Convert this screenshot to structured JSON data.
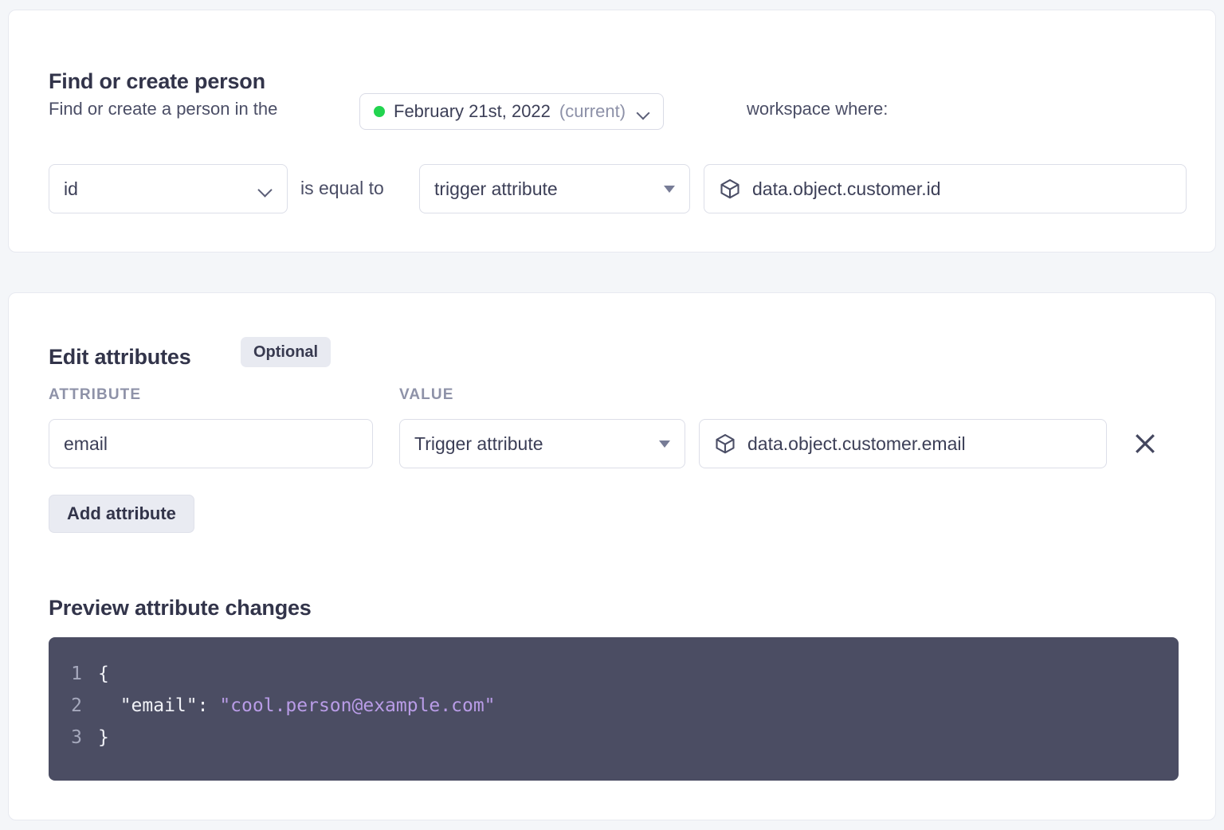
{
  "find_card": {
    "title": "Find or create person",
    "lead_text": "Find or create a person in the",
    "workspace": {
      "name": "February 21st, 2022",
      "status": "(current)",
      "dot_color": "#22d44f"
    },
    "trailing_text": "workspace where:",
    "condition": {
      "attribute_value": "id",
      "operator_label": "is equal to",
      "source_value": "trigger attribute",
      "path_value": "data.object.customer.id",
      "path_icon": "cube-icon"
    }
  },
  "edit_card": {
    "title": "Edit attributes",
    "badge": "Optional",
    "columns": {
      "attribute": "ATTRIBUTE",
      "value": "VALUE"
    },
    "rows": [
      {
        "attribute": "email",
        "source": "Trigger attribute",
        "path": "data.object.customer.email",
        "path_icon": "cube-icon",
        "remove_icon": "close-icon"
      }
    ],
    "add_button": "Add attribute",
    "preview_title": "Preview attribute changes",
    "preview_code": {
      "lines": [
        {
          "number": "1",
          "open": "{",
          "key": "",
          "value": ""
        },
        {
          "number": "2",
          "open": "",
          "key": "  \"email\": ",
          "value": "\"cool.person@example.com\""
        },
        {
          "number": "3",
          "open": "}",
          "key": "",
          "value": ""
        }
      ],
      "line1_number": "1",
      "line1_text": "{",
      "line2_number": "2",
      "line2_key": "  \"email\": ",
      "line2_value": "\"cool.person@example.com\"",
      "line3_number": "3",
      "line3_text": "}"
    }
  },
  "colors": {
    "page_background": "#f4f6f9",
    "card_background": "#ffffff",
    "card_border": "#e7e9f0",
    "accent_green": "#22d44f",
    "code_background": "#4b4d63",
    "code_string": "#b99ce7",
    "text_primary": "#32344a",
    "text_muted": "#8d91a8"
  }
}
